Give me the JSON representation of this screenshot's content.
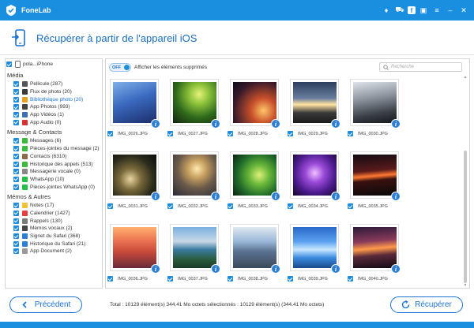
{
  "window": {
    "title": "FoneLab"
  },
  "header": {
    "title": "Récupérer à partir de l'appareil iOS"
  },
  "sidebar": {
    "device": "pola...iPhone",
    "groups": [
      {
        "label": "Média",
        "items": [
          {
            "label": "Pellicule (287)",
            "icon": "camera-roll-icon",
            "color": "#555"
          },
          {
            "label": "Flux de photo (20)",
            "icon": "photo-stream-icon",
            "color": "#3a3a3a"
          },
          {
            "label": "Bibliothèque photo (20)",
            "icon": "photo-library-icon",
            "color": "#e8a020",
            "selected": true
          },
          {
            "label": "App Photos (993)",
            "icon": "app-photos-icon",
            "color": "#444"
          },
          {
            "label": "App Vidéos (1)",
            "icon": "app-videos-icon",
            "color": "#3d6fb5"
          },
          {
            "label": "App Audio (0)",
            "icon": "app-audio-icon",
            "color": "#d63030"
          }
        ]
      },
      {
        "label": "Message & Contacts",
        "items": [
          {
            "label": "Messages (6)",
            "icon": "messages-icon",
            "color": "#3cba3c"
          },
          {
            "label": "Pièces-jointes du message (2)",
            "icon": "message-attachments-icon",
            "color": "#3cba3c"
          },
          {
            "label": "Contacts (6310)",
            "icon": "contacts-icon",
            "color": "#8c6a4a"
          },
          {
            "label": "Historique des appels (513)",
            "icon": "call-history-icon",
            "color": "#3cba3c"
          },
          {
            "label": "Messagerie vocale (0)",
            "icon": "voicemail-icon",
            "color": "#888"
          },
          {
            "label": "WhatsApp (10)",
            "icon": "whatsapp-icon",
            "color": "#25c04a"
          },
          {
            "label": "Pièces-jointes WhatsApp (0)",
            "icon": "whatsapp-attachments-icon",
            "color": "#25c04a"
          }
        ]
      },
      {
        "label": "Mémos & Autres",
        "items": [
          {
            "label": "Notes (17)",
            "icon": "notes-icon",
            "color": "#f2c230"
          },
          {
            "label": "Calendrier (1427)",
            "icon": "calendar-icon",
            "color": "#e84040"
          },
          {
            "label": "Rappels (130)",
            "icon": "reminders-icon",
            "color": "#7a7a7a"
          },
          {
            "label": "Mémos vocaux (2)",
            "icon": "voice-memos-icon",
            "color": "#444"
          },
          {
            "label": "Signet du Safari (368)",
            "icon": "safari-bookmarks-icon",
            "color": "#2d7fd6"
          },
          {
            "label": "Historique du Safari (21)",
            "icon": "safari-history-icon",
            "color": "#2d7fd6"
          },
          {
            "label": "App Document (2)",
            "icon": "app-document-icon",
            "color": "#999"
          }
        ]
      }
    ]
  },
  "content": {
    "toggle_label": "OFF",
    "show_deleted_label": "Afficher les éléments supprimés",
    "search_placeholder": "Recherche",
    "photos": [
      {
        "name": "IMG_0026.JPG",
        "style": "linear-gradient(160deg,#7fb0e8 0%,#3a6ac0 45%,#1d2e6a 100%)"
      },
      {
        "name": "IMG_0027.JPG",
        "style": "radial-gradient(circle at 60% 30%,#e8f27a 0%,#8ec43a 25%,#2f6a1c 60%,#12240c 100%)"
      },
      {
        "name": "IMG_0028.JPG",
        "style": "radial-gradient(circle at 70% 70%,#ffc66a 0%,#c8502a 30%,#3a1a2a 70%,#0c0c1e 100%)"
      },
      {
        "name": "IMG_0029.JPG",
        "style": "linear-gradient(180deg,#2c3e5c 0%,#6a7fa0 40%,#ffe3a0 55%,#3a3a3a 75%,#1a1a1a 100%)"
      },
      {
        "name": "IMG_0030.JPG",
        "style": "linear-gradient(170deg,#dfe4ea 0%,#8a929c 40%,#3a3f46 75%,#15181c 100%)"
      },
      {
        "name": "IMG_0031.JPG",
        "style": "radial-gradient(circle at 40% 60%,#e8d6a0 0%,#7a6a3a 30%,#2a2a1c 65%,#0c0c0c 100%)"
      },
      {
        "name": "IMG_0032.JPG",
        "style": "radial-gradient(circle at 55% 35%,#ffe9b0 0%,#c8a060 25%,#6a5a4a 55%,#2a2a3a 100%)"
      },
      {
        "name": "IMG_0033.JPG",
        "style": "radial-gradient(circle at 60% 50%,#e0f07a 0%,#6ab83a 30%,#1f6a2a 65%,#0c2414 100%)"
      },
      {
        "name": "IMG_0034.JPG",
        "style": "radial-gradient(circle at 50% 45%,#f0c0ff 0%,#9a4ad8 30%,#4a1a8a 65%,#140828 100%)"
      },
      {
        "name": "IMG_0035.JPG",
        "style": "linear-gradient(175deg,#120c14 0%,#5a1a1a 40%,#ff7a30 52%,#3a1010 62%,#0a0a0a 100%)"
      },
      {
        "name": "IMG_0036.JPG",
        "style": "linear-gradient(180deg,#ffb070 0%,#e87050 35%,#c84a3a 60%,#6a2a3a 100%)"
      },
      {
        "name": "IMG_0037.JPG",
        "style": "linear-gradient(180deg,#7ab0e0 0%,#c8d8e8 35%,#3a7aa0 55%,#2a5a3a 80%,#1a3a2a 100%)"
      },
      {
        "name": "IMG_0038.JPG",
        "style": "linear-gradient(180deg,#dfe8f0 0%,#9ab8d8 35%,#5a7090 60%,#3a4a5a 100%)"
      },
      {
        "name": "IMG_0039.JPG",
        "style": "linear-gradient(180deg,#2a6ac8 0%,#5aa0f0 35%,#c8e8ff 55%,#3a8ae0 75%,#1a4a8a 100%)"
      },
      {
        "name": "IMG_0040.JPG",
        "style": "linear-gradient(175deg,#2a1a3a 0%,#8a3a5a 35%,#ff9a4a 52%,#5a2a3a 68%,#120a14 100%)"
      }
    ]
  },
  "footer": {
    "back_label": "Précédent",
    "recover_label": "Récupérer",
    "summary": "Total : 10129 élément(s) 344.41 Mo octets sélectionnés : 10129 élément(s) (344.41 Mo octets)"
  }
}
